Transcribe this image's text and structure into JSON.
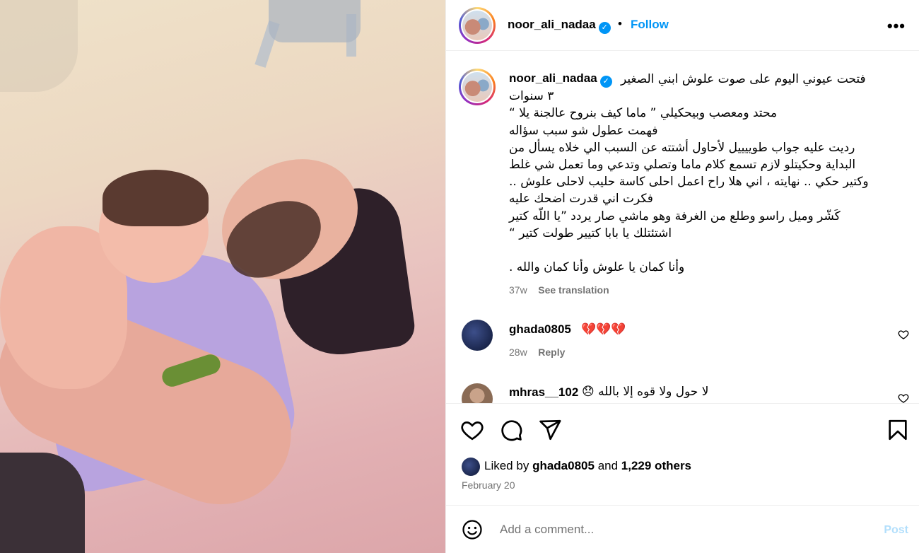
{
  "post": {
    "author": "noor_ali_nadaa",
    "follow_label": "Follow",
    "separator": "•",
    "more_label": "•••",
    "caption": [
      "فتحت عيوني اليوم على صوت علوش ابني الصغير",
      "٣ سنوات",
      "محتد ومعصب وبيحكيلي ” ماما كيف بنروح عالجنة يلا “",
      "فهمت عطول شو سبب سؤاله",
      "رديت عليه جواب طوييييل لأحاول أشتته عن السبب الي خلاه يسأل من",
      "البداية وحكيتلو لازم تسمع كلام ماما وتصلي وتدعي وما تعمل شي غلط",
      "وكتير حكي .. نهايته ، اني هلا راح اعمل احلى كاسة حليب لاحلى علوش ..",
      "فكرت اني قدرت اضحك عليه",
      "كَشّر وميل راسو وطلع من الغرفة وهو ماشي صار يردد ”يا اللّه كتير",
      "اشتئتلك يا بابا كتيير طولت كتير “",
      "",
      "وأنا كمان يا علوش وأنا كمان والله ."
    ],
    "caption_time": "37w",
    "see_translation": "See translation",
    "comments": [
      {
        "user": "ghada0805",
        "text": "💔💔💔",
        "time": "28w",
        "reply": "Reply"
      },
      {
        "user": "mhras__102",
        "text": "لا حول ولا قوه إلا بالله 😞"
      }
    ],
    "liked_by_prefix": "Liked by",
    "liked_by_user": "ghada0805",
    "liked_by_and": "and",
    "liked_by_others": "1,229 others",
    "date": "February 20",
    "comment_placeholder": "Add a comment...",
    "post_label": "Post"
  },
  "colors": {
    "accent": "#0095f6",
    "muted": "#737373",
    "post_disabled": "#b2dffc"
  },
  "icons": [
    "verified-icon",
    "more-icon",
    "heart-icon",
    "comment-icon",
    "share-icon",
    "bookmark-icon",
    "emoji-icon"
  ]
}
